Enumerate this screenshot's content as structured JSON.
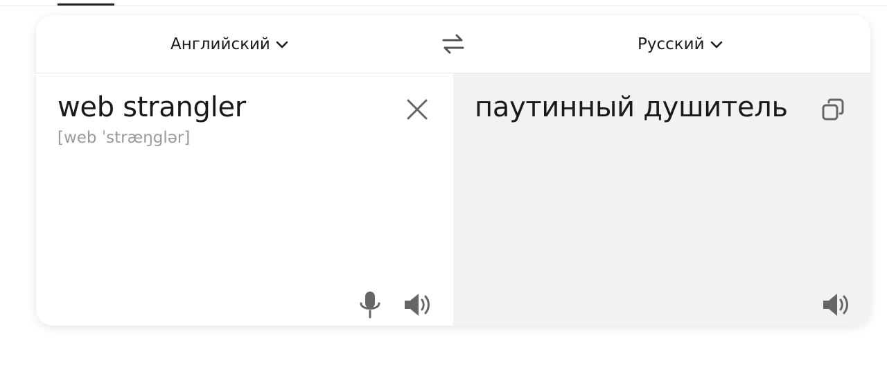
{
  "header": {
    "active_tab_indicator": true
  },
  "language_bar": {
    "source_language": "Английский",
    "target_language": "Русский",
    "swap_icon": "swap-arrows-icon"
  },
  "source_pane": {
    "text": "web strangler",
    "transcription": "[web ˈstræŋglər]",
    "icons": [
      "close-icon",
      "microphone-icon",
      "speaker-icon"
    ]
  },
  "target_pane": {
    "text": "паутинный душитель",
    "icons": [
      "copy-icon",
      "speaker-icon"
    ]
  },
  "colors": {
    "text": "#1a1a1a",
    "muted": "#999999",
    "icon": "#666666",
    "target_bg": "#f2f2f2"
  }
}
